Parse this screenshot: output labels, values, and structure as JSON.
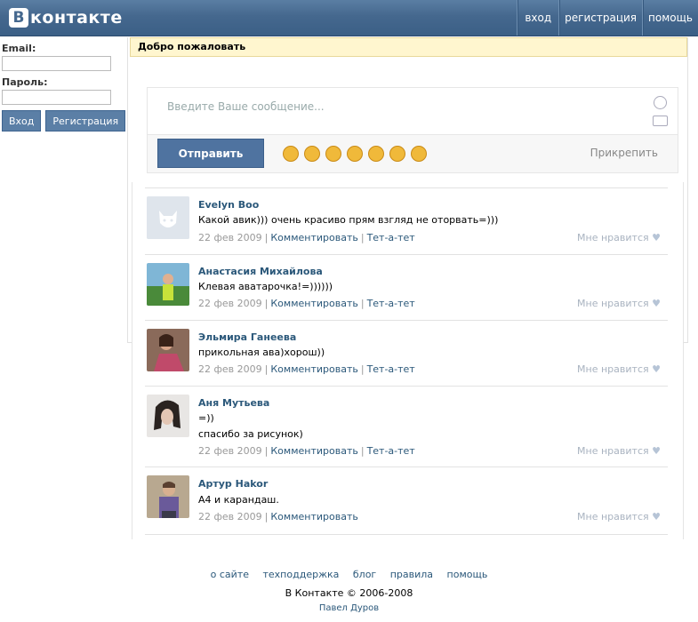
{
  "header": {
    "logo_letter": "В",
    "logo_text": "контакте",
    "nav": [
      "вход",
      "регистрация",
      "помощь"
    ]
  },
  "login": {
    "email_label": "Email:",
    "password_label": "Пароль:",
    "email_value": "",
    "password_value": "",
    "login_button": "Вход",
    "register_button": "Регистрация"
  },
  "welcome_title": "Добро пожаловать",
  "compose": {
    "placeholder": "Введите Ваше сообщение...",
    "send_button": "Отправить",
    "attach": "Прикрепить",
    "smiley_icons": [
      "laugh-emoji-icon",
      "beach-emoji-icon",
      "cool-emoji-icon",
      "sad-emoji-icon",
      "angry-emoji-icon",
      "wink-emoji-icon",
      "happy-emoji-icon"
    ]
  },
  "comments": [
    {
      "name": "Evelyn Boo",
      "lines": [
        "Какой авик))) очень красиво прям взгляд не оторвать=)))"
      ],
      "date": "22 фев 2009",
      "comment_link": "Комментировать",
      "tete_link": "Тет-а-тет",
      "like": "Мне нравится"
    },
    {
      "name": "Анастасия Михайлова",
      "lines": [
        "Клевая аватарочка!=))))))"
      ],
      "date": "22 фев 2009",
      "comment_link": "Комментировать",
      "tete_link": "Тет-а-тет",
      "like": "Мне нравится"
    },
    {
      "name": "Эльмира Ганеева",
      "lines": [
        "прикольная ава)хорош))"
      ],
      "date": "22 фев 2009",
      "comment_link": "Комментировать",
      "tete_link": "Тет-а-тет",
      "like": "Мне нравится"
    },
    {
      "name": "Аня Мутьева",
      "lines": [
        "=))",
        "спасибо за рисунок)"
      ],
      "date": "22 фев 2009",
      "comment_link": "Комментировать",
      "tete_link": "Тет-а-тет",
      "like": "Мне нравится"
    },
    {
      "name": "Артур Hakor",
      "lines": [
        "А4 и карандаш."
      ],
      "date": "22 фев 2009",
      "comment_link": "Комментировать",
      "tete_link": "",
      "like": "Мне нравится"
    }
  ],
  "footer": {
    "links": [
      "о сайте",
      "техподдержка",
      "блог",
      "правила",
      "помощь"
    ],
    "copyright": "В Контакте © 2006-2008",
    "author": "Павел Дуров"
  }
}
